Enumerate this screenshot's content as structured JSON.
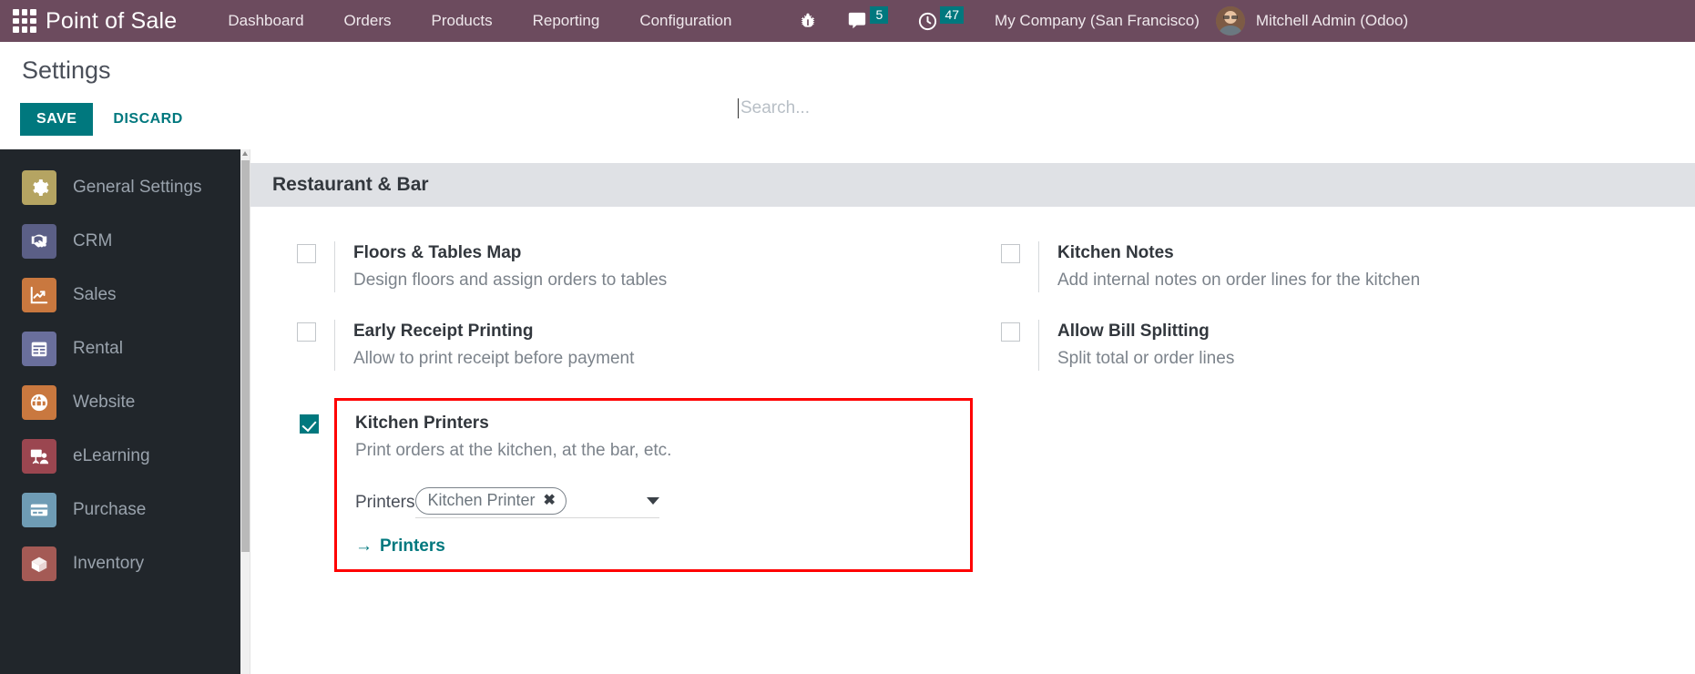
{
  "navbar": {
    "brand": "Point of Sale",
    "apps_icon": "apps-grid-icon",
    "menu": [
      {
        "label": "Dashboard"
      },
      {
        "label": "Orders"
      },
      {
        "label": "Products"
      },
      {
        "label": "Reporting"
      },
      {
        "label": "Configuration"
      }
    ],
    "systray": {
      "debug_icon": "bug-icon",
      "messages_icon": "chat-bubble-icon",
      "messages_count": "5",
      "activities_icon": "clock-icon",
      "activities_count": "47",
      "badge_color": "#00787E"
    },
    "company": "My Company (San Francisco)",
    "user": "Mitchell Admin (Odoo)",
    "bg_color": "#6C4B5E"
  },
  "control_panel": {
    "title": "Settings",
    "save_label": "SAVE",
    "discard_label": "DISCARD",
    "accent_color": "#00787E"
  },
  "search": {
    "placeholder": "Search...",
    "value": ""
  },
  "sidebar": {
    "items": [
      {
        "label": "General Settings",
        "icon": "gear-icon",
        "color": "#b5a462"
      },
      {
        "label": "CRM",
        "icon": "handshake-icon",
        "color": "#5b5f86"
      },
      {
        "label": "Sales",
        "icon": "chart-line-icon",
        "color": "#c9783f"
      },
      {
        "label": "Rental",
        "icon": "calendar-icon",
        "color": "#6a6f9c"
      },
      {
        "label": "Website",
        "icon": "globe-icon",
        "color": "#c9783f"
      },
      {
        "label": "eLearning",
        "icon": "presentation-icon",
        "color": "#9b4650"
      },
      {
        "label": "Purchase",
        "icon": "credit-card-icon",
        "color": "#6f9cb5"
      },
      {
        "label": "Inventory",
        "icon": "box-icon",
        "color": "#a45a55"
      }
    ]
  },
  "main": {
    "section_title": "Restaurant & Bar",
    "highlight_color": "#ff0000",
    "left_settings": [
      {
        "title": "Floors & Tables Map",
        "desc": "Design floors and assign orders to tables",
        "checked": false,
        "highlighted": false
      },
      {
        "title": "Early Receipt Printing",
        "desc": "Allow to print receipt before payment",
        "checked": false,
        "highlighted": false
      },
      {
        "title": "Kitchen Printers",
        "desc": "Print orders at the kitchen, at the bar, etc.",
        "checked": true,
        "highlighted": true,
        "field": {
          "label": "Printers",
          "tags": [
            {
              "label": "Kitchen Printer",
              "remove_icon": "close-x-icon"
            }
          ],
          "dropdown_icon": "chevron-down-icon"
        },
        "internal_link": {
          "arrow": "→",
          "label": "Printers"
        }
      }
    ],
    "right_settings": [
      {
        "title": "Kitchen Notes",
        "desc": "Add internal notes on order lines for the kitchen",
        "checked": false,
        "highlighted": false
      },
      {
        "title": "Allow Bill Splitting",
        "desc": "Split total or order lines",
        "checked": false,
        "highlighted": false
      }
    ]
  }
}
